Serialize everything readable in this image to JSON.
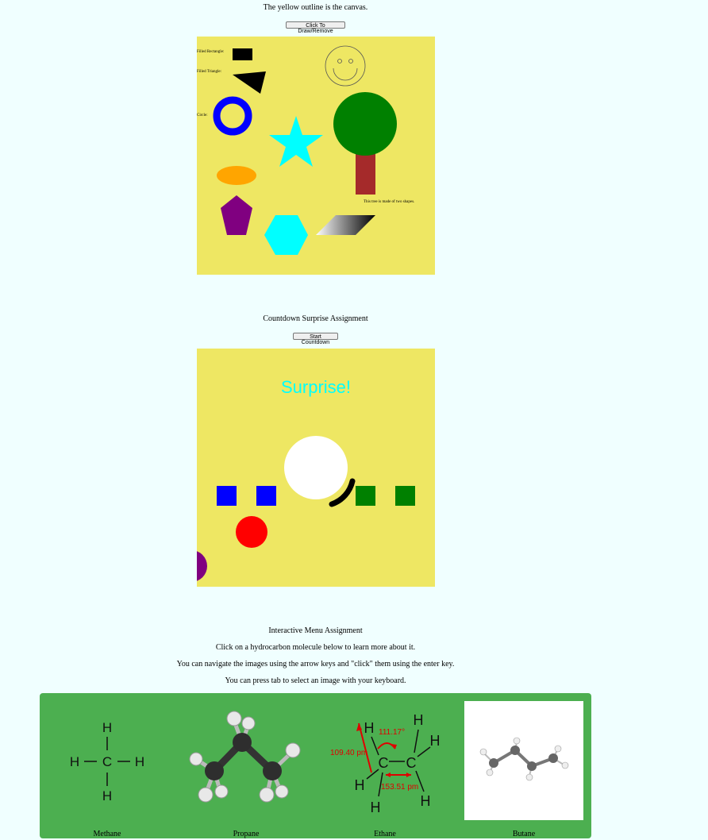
{
  "section1": {
    "caption": "The yellow outline is the canvas.",
    "button_label": "Click To Draw/Remove",
    "labels": {
      "filled_rectangle": "Filled Rectangle:",
      "filled_triangle": "Filled Triangle:",
      "circle": "Circle:",
      "tree_note": "This tree is made of two shapes."
    },
    "canvas_color": "#eee763"
  },
  "section2": {
    "title": "Countdown Surprise Assignment",
    "button_label": "Start Countdown",
    "surprise_text": "Surprise!",
    "surprise_color": "#00ffff"
  },
  "section3": {
    "title": "Interactive Menu Assignment",
    "instructions": [
      "Click on a hydrocarbon molecule below to learn more about it.",
      "You can navigate the images using the arrow keys and \"click\" them using the enter key.",
      "You can press tab to select an image with your keyboard."
    ],
    "menu_bg": "#4caf50",
    "items": [
      {
        "name": "Methane",
        "icon": "methane-structure-icon"
      },
      {
        "name": "Propane",
        "icon": "propane-ball-stick-icon"
      },
      {
        "name": "Ethane",
        "icon": "ethane-structure-icon",
        "annotations": {
          "angle1": "111.17°",
          "angle2": "109.40 pm",
          "bond": "153.51 pm"
        }
      },
      {
        "name": "Butane",
        "icon": "butane-ball-stick-icon"
      }
    ]
  }
}
